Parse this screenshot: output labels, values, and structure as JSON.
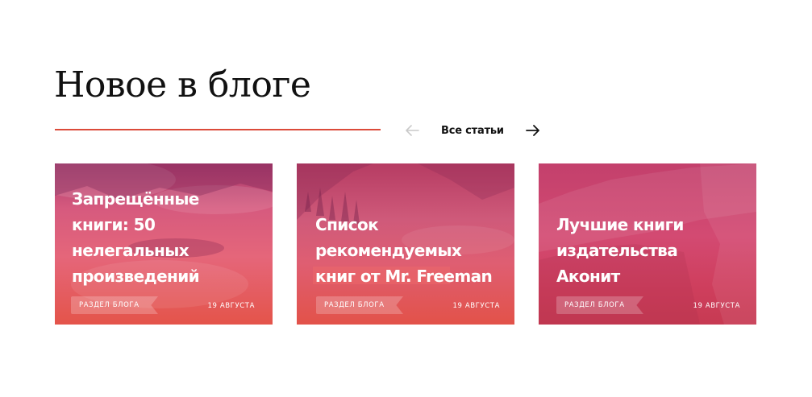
{
  "section": {
    "title": "Новое в блоге",
    "accent_color": "#dc4b3a"
  },
  "nav": {
    "prev_icon": "arrow-left-icon",
    "next_icon": "arrow-right-icon",
    "all_label": "Все статьи"
  },
  "cards": [
    {
      "title": "Запрещённые книги: 50 нелегальных произведений",
      "tag": "РАЗДЕЛ БЛОГА",
      "date": "19 АВГУСТА"
    },
    {
      "title": "Список рекомендуемых книг от Mr. Freeman",
      "tag": "РАЗДЕЛ БЛОГА",
      "date": "19 АВГУСТА"
    },
    {
      "title": "Лучшие книги издательства Аконит",
      "tag": "РАЗДЕЛ БЛОГА",
      "date": "19 АВГУСТА"
    }
  ]
}
